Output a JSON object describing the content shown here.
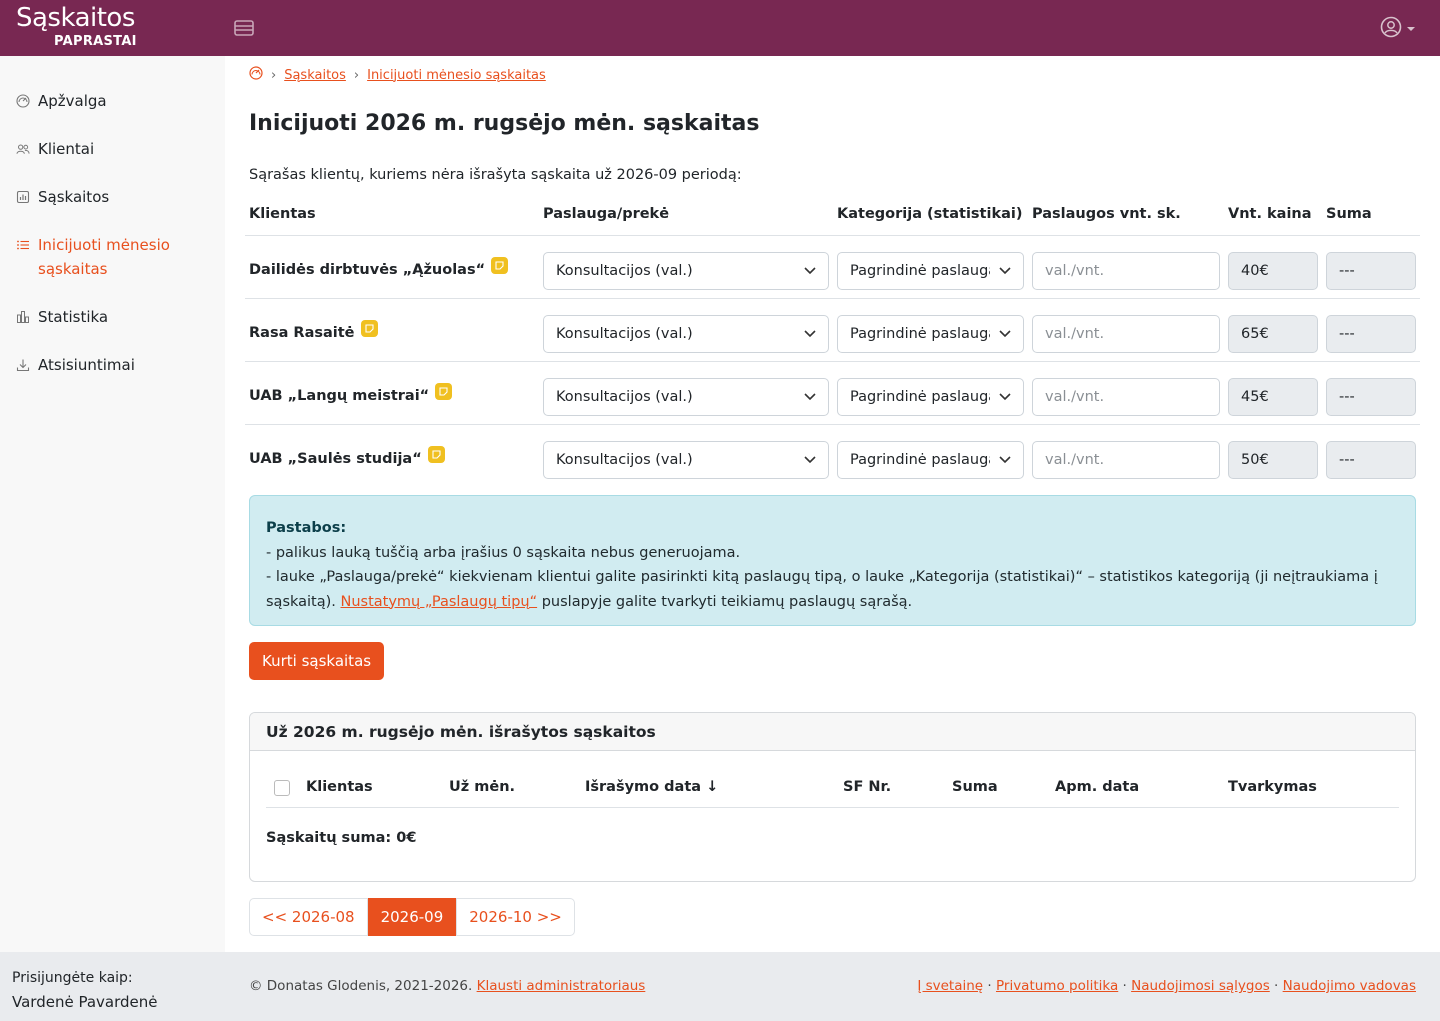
{
  "brand": {
    "top": "Sąskaitos",
    "bottom": "PAPRASTAI"
  },
  "sidebar": {
    "items": [
      {
        "label": "Apžvalga",
        "icon": "dashboard-icon"
      },
      {
        "label": "Klientai",
        "icon": "users-icon"
      },
      {
        "label": "Sąskaitos",
        "icon": "invoice-icon"
      },
      {
        "label": "Inicijuoti mėnesio sąskaitas",
        "icon": "list-icon",
        "active": true
      },
      {
        "label": "Statistika",
        "icon": "stats-icon"
      },
      {
        "label": "Atsisiuntimai",
        "icon": "download-icon"
      }
    ],
    "login_label": "Prisijungėte kaip:",
    "user_name": "Vardenė Pavardenė"
  },
  "breadcrumb": {
    "item1": "Sąskaitos",
    "item2": "Inicijuoti mėnesio sąskaitas"
  },
  "page_title": "Inicijuoti 2026 m. rugsėjo mėn. sąskaitas",
  "intro": "Sąrašas klientų, kuriems nėra išrašyta sąskaita už 2026-09 periodą:",
  "table": {
    "headers": [
      "Klientas",
      "Paslauga/prekė",
      "Kategorija (statistikai)",
      "Paslaugos vnt. sk.",
      "Vnt. kaina",
      "Suma"
    ],
    "qty_placeholder": "val./vnt.",
    "rows": [
      {
        "client": "Dailidės dirbtuvės „Ąžuolas“",
        "service": "Konsultacijos (val.)",
        "category": "Pagrindinė paslauga",
        "price": "40€",
        "sum": "---"
      },
      {
        "client": "Rasa Rasaitė",
        "service": "Konsultacijos (val.)",
        "category": "Pagrindinė paslauga",
        "price": "65€",
        "sum": "---"
      },
      {
        "client": "UAB „Langų meistrai“",
        "service": "Konsultacijos (val.)",
        "category": "Pagrindinė paslauga",
        "price": "45€",
        "sum": "---"
      },
      {
        "client": "UAB „Saulės studija“",
        "service": "Konsultacijos (val.)",
        "category": "Pagrindinė paslauga",
        "price": "50€",
        "sum": "---"
      }
    ]
  },
  "notes": {
    "title": "Pastabos:",
    "line1": "- palikus lauką tuščią arba įrašius 0 sąskaita nebus generuojama.",
    "line2": "- lauke „Paslauga/prekė“ kiekvienam klientui galite pasirinkti kitą paslaugų tipą, o lauke „Kategorija (statistikai)“ – statistikos kategoriją (ji neįtraukiama į sąskaitą).",
    "link": "Nustatymų „Paslaugų tipų“",
    "line2_end": "puslapyje galite tvarkyti teikiamų paslaugų sąrašą."
  },
  "create_button": "Kurti sąskaitas",
  "issued": {
    "title": "Už 2026 m. rugsėjo mėn. išrašytos sąskaitos",
    "headers": [
      "Klientas",
      "Už mėn.",
      "Išrašymo data ↓",
      "SF Nr.",
      "Suma",
      "Apm. data",
      "Tvarkymas"
    ],
    "sum_label": "Sąskaitų suma: 0€"
  },
  "pager": {
    "prev": "<< 2026-08",
    "current": "2026-09",
    "next": "2026-10 >>"
  },
  "footer": {
    "copyright": "© Donatas Glodenis, 2021-2026.",
    "ask_admin": "Klausti administratoriaus",
    "links": [
      "Į svetainę",
      "Privatumo politika",
      "Naudojimosi sąlygos",
      "Naudojimo vadovas"
    ]
  },
  "colors": {
    "brand": "#782852",
    "accent": "#e8501e",
    "info_bg": "#d1ecf1"
  }
}
